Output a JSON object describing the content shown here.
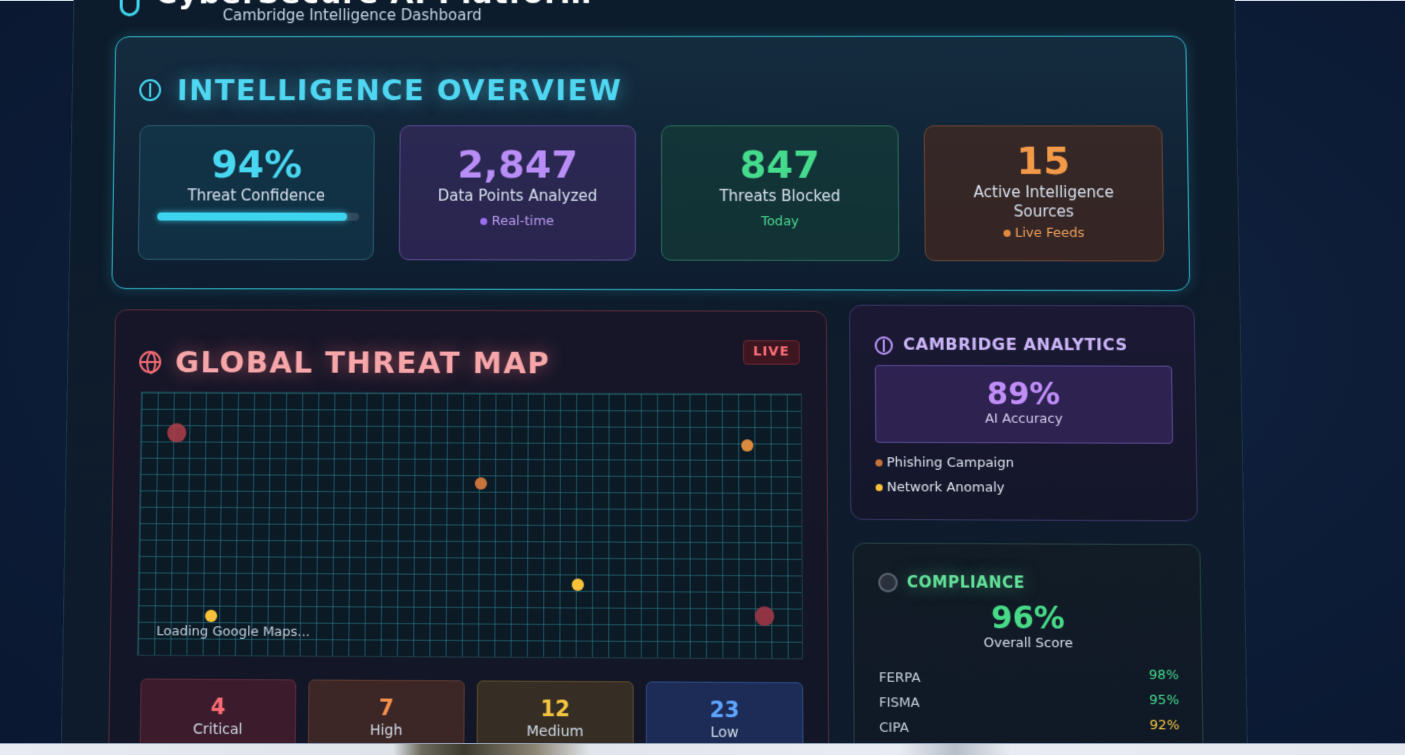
{
  "header": {
    "title": "CyberSecure AI Platform",
    "subtitle": "Cambridge Intelligence Dashboard"
  },
  "overview": {
    "title": "INTELLIGENCE OVERVIEW",
    "stats": [
      {
        "value": "94%",
        "label": "Threat Confidence",
        "progress": 0.94
      },
      {
        "value": "2,847",
        "label": "Data Points Analyzed",
        "sub": "Real-time"
      },
      {
        "value": "847",
        "label": "Threats Blocked",
        "sub": "Today"
      },
      {
        "value": "15",
        "label": "Active Intelligence Sources",
        "sub": "Live Feeds"
      }
    ]
  },
  "threat_map": {
    "title": "GLOBAL THREAT MAP",
    "badge": "LIVE",
    "loading_text": "Loading Google Maps...",
    "severity": [
      {
        "count": "4",
        "label": "Critical"
      },
      {
        "count": "7",
        "label": "High"
      },
      {
        "count": "12",
        "label": "Medium"
      },
      {
        "count": "23",
        "label": "Low"
      }
    ]
  },
  "analytics": {
    "title": "CAMBRIDGE ANALYTICS",
    "accuracy_value": "89%",
    "accuracy_label": "AI Accuracy",
    "alerts": [
      "Phishing Campaign",
      "Network Anomaly"
    ]
  },
  "compliance": {
    "title": "COMPLIANCE",
    "score_value": "96%",
    "score_label": "Overall Score",
    "items": [
      {
        "name": "FERPA",
        "value": "98%"
      },
      {
        "name": "FISMA",
        "value": "95%"
      },
      {
        "name": "CIPA",
        "value": "92%"
      }
    ]
  },
  "colors": {
    "accent_cyan": "#48d6f1",
    "accent_purple": "#b88ef6",
    "accent_green": "#45db8c",
    "accent_orange": "#f39a48",
    "critical": "#ff6b73",
    "medium": "#f5c542",
    "low": "#5ea4ff"
  }
}
